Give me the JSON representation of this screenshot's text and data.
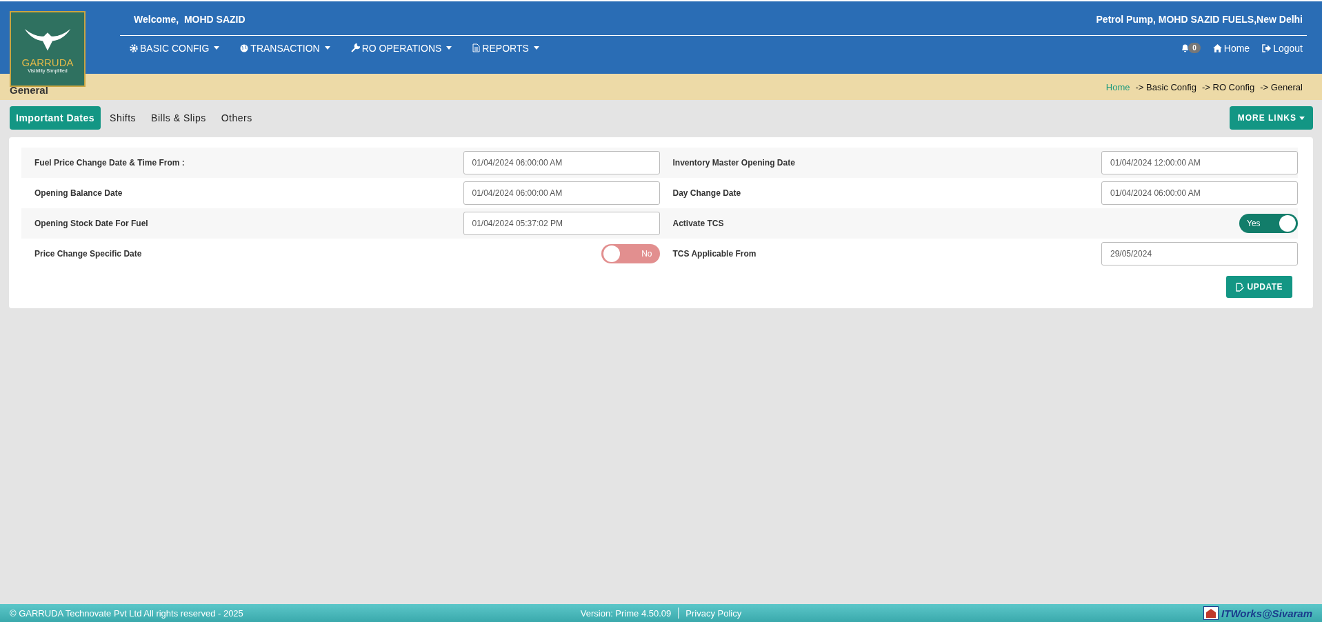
{
  "logo": {
    "name": "GARRUDA",
    "tagline": "Visibility Simplified"
  },
  "header": {
    "welcome": "Welcome,",
    "user": "MOHD SAZID",
    "location": "Petrol Pump, MOHD SAZID FUELS,New Delhi"
  },
  "menu": [
    {
      "label": "BASIC CONFIG"
    },
    {
      "label": "TRANSACTION"
    },
    {
      "label": "RO OPERATIONS"
    },
    {
      "label": "REPORTS"
    }
  ],
  "notifications": {
    "count": "0"
  },
  "top_links": [
    {
      "label": "Home"
    },
    {
      "label": "Logout"
    }
  ],
  "page_title": "General",
  "breadcrumb": {
    "home": "Home",
    "trail": [
      "-> Basic Config",
      "-> RO Config",
      "-> General"
    ]
  },
  "tabs": [
    {
      "label": "Important Dates",
      "selected": true
    },
    {
      "label": "Shifts",
      "selected": false
    },
    {
      "label": "Bills & Slips",
      "selected": false
    },
    {
      "label": "Others",
      "selected": false
    }
  ],
  "more_links": "MORE LINKS",
  "left_fields": [
    {
      "label": "Fuel Price Change Date & Time From :",
      "kind": "input",
      "value": "01/04/2024 06:00:00 AM"
    },
    {
      "label": "Opening Balance Date",
      "kind": "input",
      "value": "01/04/2024 06:00:00 AM"
    },
    {
      "label": "Opening Stock Date For Fuel",
      "kind": "input",
      "value": "01/04/2024 05:37:02 PM"
    },
    {
      "label": "Price Change Specific Date",
      "kind": "toggle",
      "on": false,
      "text": "No"
    }
  ],
  "right_fields": [
    {
      "label": "Inventory Master Opening Date",
      "kind": "input",
      "value": "01/04/2024 12:00:00 AM"
    },
    {
      "label": "Day Change Date",
      "kind": "input",
      "value": "01/04/2024 06:00:00 AM"
    },
    {
      "label": "Activate TCS",
      "kind": "toggle",
      "on": true,
      "text": "Yes"
    },
    {
      "label": "TCS Applicable From",
      "kind": "input",
      "value": "29/05/2024"
    }
  ],
  "update_button": "UPDATE",
  "footer": {
    "copyright": "© GARRUDA Technovate Pvt Ltd All rights reserved - 2025",
    "version": "Version: Prime 4.50.09",
    "privacy": "Privacy Policy",
    "brand": "ITWorks@Sivaram"
  }
}
